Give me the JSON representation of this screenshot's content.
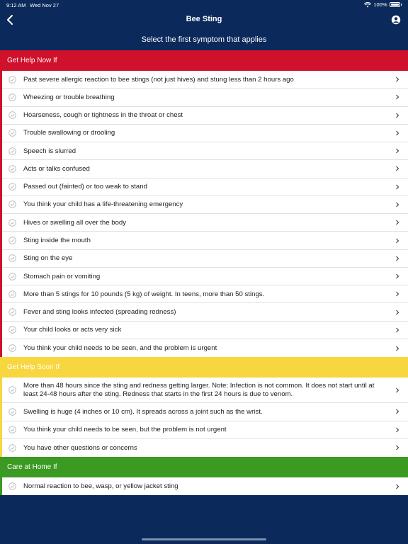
{
  "status_bar": {
    "time": "9:12 AM",
    "date": "Wed Nov 27",
    "battery": "100%"
  },
  "nav": {
    "title": "Bee Sting",
    "back_icon": "chevron-left-icon",
    "account_icon": "account-icon"
  },
  "subtitle": "Select the first symptom that applies",
  "colors": {
    "navy": "#0b2a5b",
    "red": "#d0112b",
    "yellow": "#f8d63f",
    "green": "#3a9a21"
  },
  "sections": {
    "now": {
      "header": "Get Help Now If",
      "items": [
        "Past severe allergic reaction to bee stings (not just hives) and stung less than 2 hours ago",
        "Wheezing or trouble breathing",
        "Hoarseness, cough or tightness in the throat or chest",
        "Trouble swallowing or drooling",
        "Speech is slurred",
        "Acts or talks confused",
        "Passed out (fainted) or too weak to stand",
        "You think your child has a life-threatening emergency",
        "Hives or swelling all over the body",
        "Sting inside the mouth",
        "Sting on the eye",
        "Stomach pain or vomiting",
        "More than 5 stings for 10 pounds (5 kg) of weight. In teens, more than 50 stings.",
        "Fever and sting looks infected (spreading redness)",
        "Your child looks or acts very sick",
        "You think your child needs to be seen, and the problem is urgent"
      ]
    },
    "soon": {
      "header": "Get Help Soon If",
      "items": [
        "More than 48 hours since the sting and redness getting larger. Note: Infection is not common. It does not start until at least 24-48 hours after the sting. Redness that starts in the first 24 hours is due to venom.",
        "Swelling is huge (4 inches or 10 cm). It spreads across a joint such as the wrist.",
        "You think your child needs to be seen, but the problem is not urgent",
        "You have other questions or concerns"
      ]
    },
    "home": {
      "header": "Care at Home If",
      "items": [
        "Normal reaction to bee, wasp, or yellow jacket sting"
      ]
    }
  }
}
